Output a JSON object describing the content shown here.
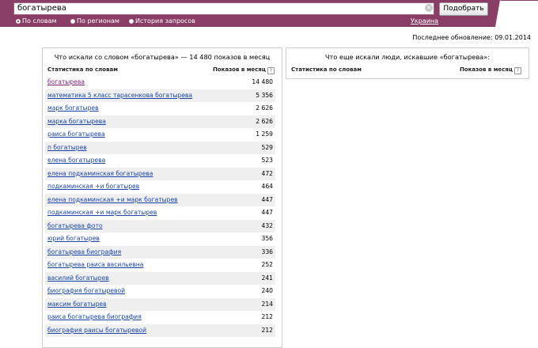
{
  "colors": {
    "topbar": "#8a3e66",
    "link": "#1a44a8",
    "visited": "#7a1e77"
  },
  "search": {
    "value": "богатырева",
    "clear_icon": "close-icon",
    "button_label": "Подобрать"
  },
  "tabs": [
    {
      "label": "По словам",
      "selected": true
    },
    {
      "label": "По регионам",
      "selected": false
    },
    {
      "label": "История запросов",
      "selected": false
    }
  ],
  "region": "Украина",
  "last_update": "Последнее обновление: 09.01.2014",
  "left": {
    "title": "Что искали со словом «богатырева» — 14 480 показов в месяц",
    "col_query": "Статистика по словам",
    "col_count": "Показов в месяц",
    "help": "?",
    "rows": [
      {
        "q": "богатырева",
        "n": "14 480"
      },
      {
        "q": "математика 5 класс тарасенкова богатырева",
        "n": "5 356"
      },
      {
        "q": "марк богатырев",
        "n": "2 626"
      },
      {
        "q": "марка богатырева",
        "n": "2 626"
      },
      {
        "q": "раиса богатырева",
        "n": "1 259"
      },
      {
        "q": "п богатырев",
        "n": "529"
      },
      {
        "q": "елена богатырева",
        "n": "523"
      },
      {
        "q": "елена подкаминская богатырева",
        "n": "472"
      },
      {
        "q": "подкаминская +и богатырев",
        "n": "464"
      },
      {
        "q": "елена подкаминская +и марк богатырев",
        "n": "447"
      },
      {
        "q": "подкаминская +и марк богатырев",
        "n": "447"
      },
      {
        "q": "богатырева фото",
        "n": "432"
      },
      {
        "q": "юрий богатырев",
        "n": "356"
      },
      {
        "q": "богатырева биография",
        "n": "336"
      },
      {
        "q": "богатырева раиса васильевна",
        "n": "252"
      },
      {
        "q": "василий богатырев",
        "n": "241"
      },
      {
        "q": "биография богатыревой",
        "n": "240"
      },
      {
        "q": "максим богатырев",
        "n": "214"
      },
      {
        "q": "раиса богатырева биография",
        "n": "212"
      },
      {
        "q": "биография раисы богатыревой",
        "n": "212"
      }
    ]
  },
  "right": {
    "title": "Что еще искали люди, искавшие «богатырева»:",
    "col_query": "Статистика по словам",
    "col_count": "Показов в месяц",
    "help": "?"
  }
}
